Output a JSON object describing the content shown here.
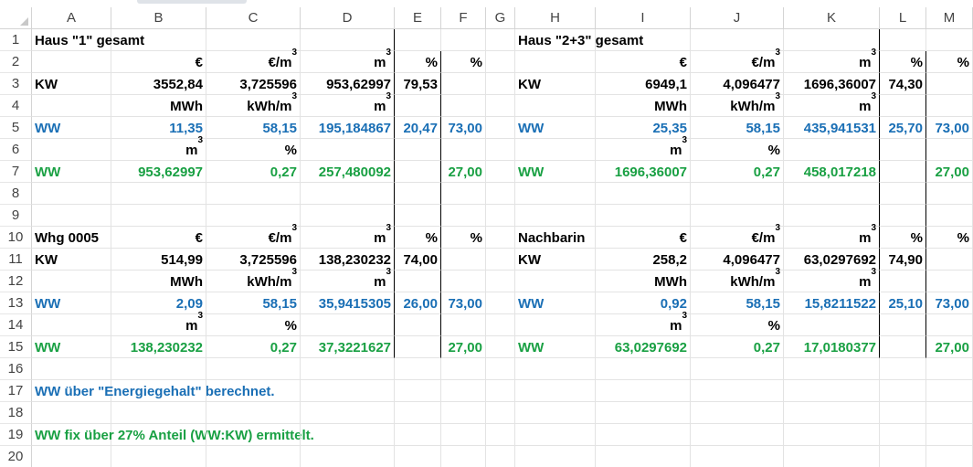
{
  "columns": [
    "A",
    "B",
    "C",
    "D",
    "E",
    "F",
    "G",
    "H",
    "I",
    "J",
    "K",
    "L",
    "M"
  ],
  "rows": [
    "1",
    "2",
    "3",
    "4",
    "5",
    "6",
    "7",
    "8",
    "9",
    "10",
    "11",
    "12",
    "13",
    "14",
    "15",
    "16",
    "17",
    "18",
    "19",
    "20"
  ],
  "colors": {
    "black": "#000000",
    "blue": "#1a6fb5",
    "green": "#19a043",
    "grid": "#e3e3e3"
  },
  "cells": [
    {
      "ref": "A1",
      "text": "Haus \"1\" gesamt",
      "color": "black"
    },
    {
      "ref": "H1",
      "text": "Haus \"2+3\" gesamt",
      "color": "black"
    },
    {
      "ref": "B2",
      "text": "€",
      "color": "black"
    },
    {
      "ref": "C2",
      "text": "€/m3",
      "color": "black"
    },
    {
      "ref": "D2",
      "text": "m3",
      "color": "black"
    },
    {
      "ref": "E2",
      "text": "%",
      "color": "black"
    },
    {
      "ref": "F2",
      "text": "%",
      "color": "black"
    },
    {
      "ref": "I2",
      "text": "€",
      "color": "black"
    },
    {
      "ref": "J2",
      "text": "€/m3",
      "color": "black"
    },
    {
      "ref": "K2",
      "text": "m3",
      "color": "black"
    },
    {
      "ref": "L2",
      "text": "%",
      "color": "black"
    },
    {
      "ref": "M2",
      "text": "%",
      "color": "black"
    },
    {
      "ref": "A3",
      "text": "KW",
      "color": "black"
    },
    {
      "ref": "B3",
      "text": "3552,84",
      "color": "black"
    },
    {
      "ref": "C3",
      "text": "3,725596",
      "color": "black"
    },
    {
      "ref": "D3",
      "text": "953,62997",
      "color": "black"
    },
    {
      "ref": "E3",
      "text": "79,53",
      "color": "black"
    },
    {
      "ref": "H3",
      "text": "KW",
      "color": "black"
    },
    {
      "ref": "I3",
      "text": "6949,1",
      "color": "black"
    },
    {
      "ref": "J3",
      "text": "4,096477",
      "color": "black"
    },
    {
      "ref": "K3",
      "text": "1696,36007",
      "color": "black"
    },
    {
      "ref": "L3",
      "text": "74,30",
      "color": "black"
    },
    {
      "ref": "B4",
      "text": "MWh",
      "color": "black"
    },
    {
      "ref": "C4",
      "text": "kWh/m3",
      "color": "black"
    },
    {
      "ref": "D4",
      "text": "m3",
      "color": "black"
    },
    {
      "ref": "I4",
      "text": "MWh",
      "color": "black"
    },
    {
      "ref": "J4",
      "text": "kWh/m3",
      "color": "black"
    },
    {
      "ref": "K4",
      "text": "m3",
      "color": "black"
    },
    {
      "ref": "A5",
      "text": "WW",
      "color": "blue"
    },
    {
      "ref": "B5",
      "text": "11,35",
      "color": "blue"
    },
    {
      "ref": "C5",
      "text": "58,15",
      "color": "blue"
    },
    {
      "ref": "D5",
      "text": "195,184867",
      "color": "blue"
    },
    {
      "ref": "E5",
      "text": "20,47",
      "color": "blue"
    },
    {
      "ref": "F5",
      "text": "73,00",
      "color": "blue"
    },
    {
      "ref": "H5",
      "text": "WW",
      "color": "blue"
    },
    {
      "ref": "I5",
      "text": "25,35",
      "color": "blue"
    },
    {
      "ref": "J5",
      "text": "58,15",
      "color": "blue"
    },
    {
      "ref": "K5",
      "text": "435,941531",
      "color": "blue"
    },
    {
      "ref": "L5",
      "text": "25,70",
      "color": "blue"
    },
    {
      "ref": "M5",
      "text": "73,00",
      "color": "blue"
    },
    {
      "ref": "B6",
      "text": "m3",
      "color": "black"
    },
    {
      "ref": "C6",
      "text": "%",
      "color": "black"
    },
    {
      "ref": "I6",
      "text": "m3",
      "color": "black"
    },
    {
      "ref": "J6",
      "text": "%",
      "color": "black"
    },
    {
      "ref": "A7",
      "text": "WW",
      "color": "green"
    },
    {
      "ref": "B7",
      "text": "953,62997",
      "color": "green"
    },
    {
      "ref": "C7",
      "text": "0,27",
      "color": "green"
    },
    {
      "ref": "D7",
      "text": "257,480092",
      "color": "green"
    },
    {
      "ref": "F7",
      "text": "27,00",
      "color": "green"
    },
    {
      "ref": "H7",
      "text": "WW",
      "color": "green"
    },
    {
      "ref": "I7",
      "text": "1696,36007",
      "color": "green"
    },
    {
      "ref": "J7",
      "text": "0,27",
      "color": "green"
    },
    {
      "ref": "K7",
      "text": "458,017218",
      "color": "green"
    },
    {
      "ref": "M7",
      "text": "27,00",
      "color": "green"
    },
    {
      "ref": "A10",
      "text": "Whg 0005",
      "color": "black"
    },
    {
      "ref": "B10",
      "text": "€",
      "color": "black"
    },
    {
      "ref": "C10",
      "text": "€/m3",
      "color": "black"
    },
    {
      "ref": "D10",
      "text": "m3",
      "color": "black"
    },
    {
      "ref": "E10",
      "text": "%",
      "color": "black"
    },
    {
      "ref": "F10",
      "text": "%",
      "color": "black"
    },
    {
      "ref": "H10",
      "text": "Nachbarin",
      "color": "black"
    },
    {
      "ref": "I10",
      "text": "€",
      "color": "black"
    },
    {
      "ref": "J10",
      "text": "€/m3",
      "color": "black"
    },
    {
      "ref": "K10",
      "text": "m3",
      "color": "black"
    },
    {
      "ref": "L10",
      "text": "%",
      "color": "black"
    },
    {
      "ref": "M10",
      "text": "%",
      "color": "black"
    },
    {
      "ref": "A11",
      "text": "KW",
      "color": "black"
    },
    {
      "ref": "B11",
      "text": "514,99",
      "color": "black"
    },
    {
      "ref": "C11",
      "text": "3,725596",
      "color": "black"
    },
    {
      "ref": "D11",
      "text": "138,230232",
      "color": "black"
    },
    {
      "ref": "E11",
      "text": "74,00",
      "color": "black"
    },
    {
      "ref": "H11",
      "text": "KW",
      "color": "black"
    },
    {
      "ref": "I11",
      "text": "258,2",
      "color": "black"
    },
    {
      "ref": "J11",
      "text": "4,096477",
      "color": "black"
    },
    {
      "ref": "K11",
      "text": "63,0297692",
      "color": "black"
    },
    {
      "ref": "L11",
      "text": "74,90",
      "color": "black"
    },
    {
      "ref": "B12",
      "text": "MWh",
      "color": "black"
    },
    {
      "ref": "C12",
      "text": "kWh/m3",
      "color": "black"
    },
    {
      "ref": "D12",
      "text": "m3",
      "color": "black"
    },
    {
      "ref": "I12",
      "text": "MWh",
      "color": "black"
    },
    {
      "ref": "J12",
      "text": "kWh/m3",
      "color": "black"
    },
    {
      "ref": "K12",
      "text": "m3",
      "color": "black"
    },
    {
      "ref": "A13",
      "text": "WW",
      "color": "blue"
    },
    {
      "ref": "B13",
      "text": "2,09",
      "color": "blue"
    },
    {
      "ref": "C13",
      "text": "58,15",
      "color": "blue"
    },
    {
      "ref": "D13",
      "text": "35,9415305",
      "color": "blue"
    },
    {
      "ref": "E13",
      "text": "26,00",
      "color": "blue"
    },
    {
      "ref": "F13",
      "text": "73,00",
      "color": "blue"
    },
    {
      "ref": "H13",
      "text": "WW",
      "color": "blue"
    },
    {
      "ref": "I13",
      "text": "0,92",
      "color": "blue"
    },
    {
      "ref": "J13",
      "text": "58,15",
      "color": "blue"
    },
    {
      "ref": "K13",
      "text": "15,8211522",
      "color": "blue"
    },
    {
      "ref": "L13",
      "text": "25,10",
      "color": "blue"
    },
    {
      "ref": "M13",
      "text": "73,00",
      "color": "blue"
    },
    {
      "ref": "B14",
      "text": "m3",
      "color": "black"
    },
    {
      "ref": "C14",
      "text": "%",
      "color": "black"
    },
    {
      "ref": "I14",
      "text": "m3",
      "color": "black"
    },
    {
      "ref": "J14",
      "text": "%",
      "color": "black"
    },
    {
      "ref": "A15",
      "text": "WW",
      "color": "green"
    },
    {
      "ref": "B15",
      "text": "138,230232",
      "color": "green"
    },
    {
      "ref": "C15",
      "text": "0,27",
      "color": "green"
    },
    {
      "ref": "D15",
      "text": "37,3221627",
      "color": "green"
    },
    {
      "ref": "F15",
      "text": "27,00",
      "color": "green"
    },
    {
      "ref": "H15",
      "text": "WW",
      "color": "green"
    },
    {
      "ref": "I15",
      "text": "63,0297692",
      "color": "green"
    },
    {
      "ref": "J15",
      "text": "0,27",
      "color": "green"
    },
    {
      "ref": "K15",
      "text": "17,0180377",
      "color": "green"
    },
    {
      "ref": "M15",
      "text": "27,00",
      "color": "green"
    },
    {
      "ref": "A17",
      "text": "WW über \"Energiegehalt\" berechnet.",
      "color": "blue"
    },
    {
      "ref": "A19",
      "text": "WW fix über 27% Anteil (WW:KW) ermittelt.",
      "color": "green"
    }
  ]
}
